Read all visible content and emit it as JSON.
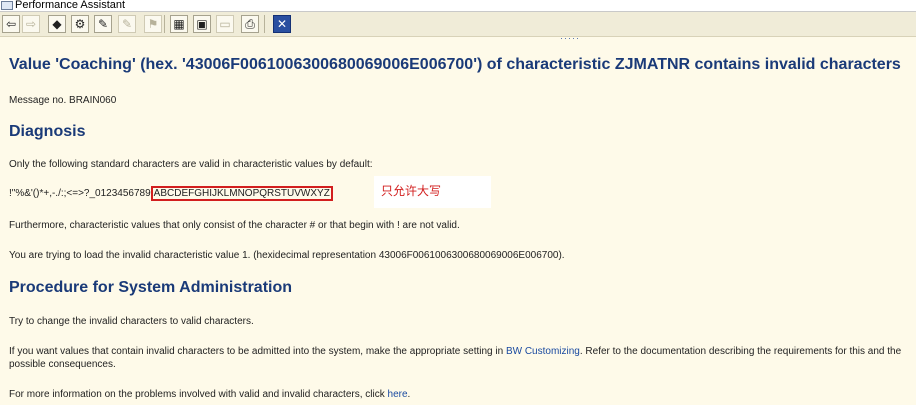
{
  "window": {
    "title": "Performance Assistant"
  },
  "toolbar": {
    "buttons": [
      {
        "icon": "back-arrow-icon",
        "glyph": "⇦",
        "enabled": true
      },
      {
        "icon": "forward-arrow-icon",
        "glyph": "⇨",
        "enabled": false
      },
      {
        "icon": "technical-info-icon",
        "glyph": "◆",
        "enabled": true
      },
      {
        "icon": "settings-icon",
        "glyph": "⚙",
        "enabled": true
      },
      {
        "icon": "edit-icon",
        "glyph": "✎",
        "enabled": true
      },
      {
        "icon": "bookmark-icon",
        "glyph": "✎",
        "enabled": false
      },
      {
        "icon": "info-icon",
        "glyph": "⚑",
        "enabled": false
      },
      {
        "icon": "table-icon",
        "glyph": "▦",
        "enabled": true
      },
      {
        "icon": "window-icon",
        "glyph": "▣",
        "enabled": true
      },
      {
        "icon": "notes-icon",
        "glyph": "▭",
        "enabled": false
      },
      {
        "icon": "print-icon",
        "glyph": "⎙",
        "enabled": true
      },
      {
        "icon": "close-icon",
        "glyph": "✕",
        "enabled": true
      }
    ]
  },
  "content": {
    "heading": "Value 'Coaching' (hex. '43006F0061006300680069006E006700') of characteristic ZJMATNR contains invalid characters",
    "message_no": "Message no. BRAIN060",
    "diagnosis_heading": "Diagnosis",
    "diagnosis_text": "Only the following standard characters are valid in characteristic values by default:",
    "valid_chars_prefix": "!\"%&'()*+,-./:;<=>?_0123456789",
    "valid_chars_highlight": "ABCDEFGHIJKLMNOPQRSTUVWXYZ",
    "annotation_note": "只允许大写",
    "furthermore_text": "Furthermore, characteristic values that only consist of the character # or that begin with ! are not valid.",
    "trying_text": "You are trying to load the invalid characteristic value 1. (hexidecimal representation 43006F0061006300680069006E006700).",
    "procedure_heading": "Procedure for System Administration",
    "try_change_text": "Try to change the invalid characters to valid characters.",
    "if_you_want_prefix": "If you want values that contain invalid characters to be admitted into the system, make the appropriate setting in ",
    "bw_customizing_link": "BW Customizing",
    "if_you_want_suffix": ". Refer to the documentation describing the requirements for this and the possible consequences.",
    "more_info_prefix": "For more information on the problems involved with valid and invalid characters, click ",
    "here_link": "here",
    "more_info_suffix": "."
  },
  "colors": {
    "background": "#fefae9",
    "heading": "#1a3a78",
    "link": "#1a4aa0",
    "highlight": "#d21e1e"
  }
}
